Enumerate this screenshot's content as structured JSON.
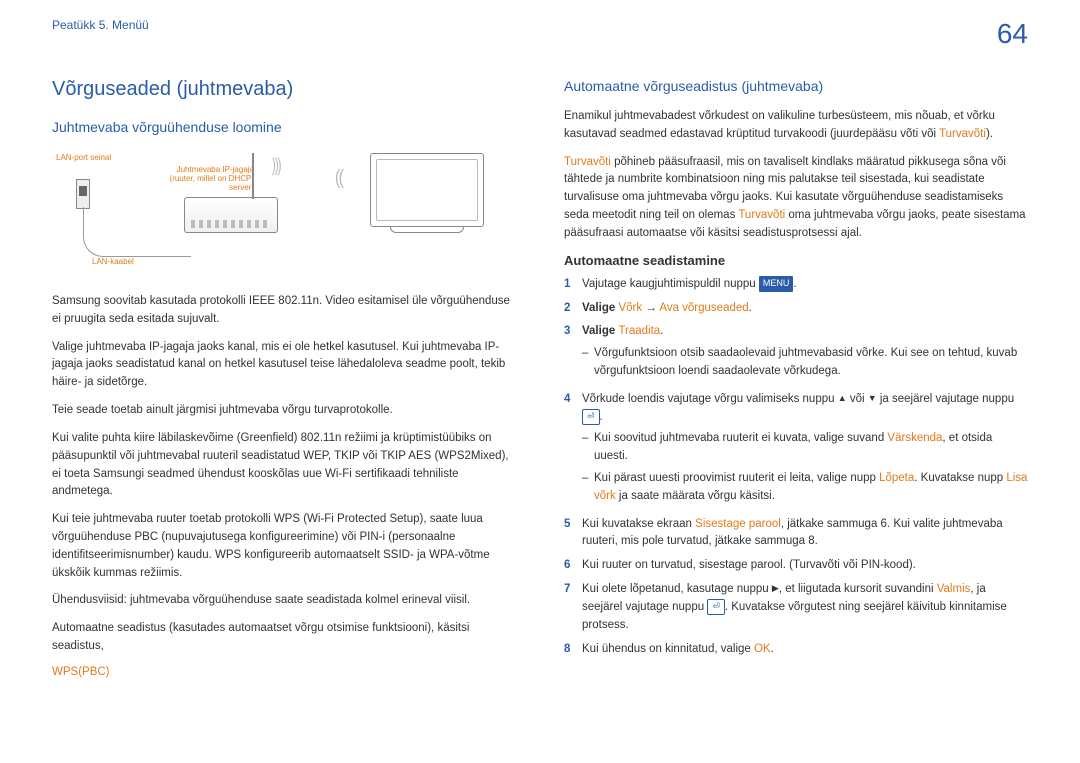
{
  "header": {
    "chapter": "Peatükk 5. Menüü",
    "page": "64"
  },
  "left": {
    "h1": "Võrguseaded (juhtmevaba)",
    "h2": "Juhtmevaba võrguühenduse loomine",
    "diag": {
      "lanport": "LAN-port seinal",
      "router": "Juhtmevaba IP-jagaja (ruuter, millel on DHCP-server)",
      "cable": "LAN-kaabel"
    },
    "p1": "Samsung soovitab kasutada protokolli IEEE 802.11n. Video esitamisel üle võrguühenduse ei pruugita seda esitada sujuvalt.",
    "p2": "Valige juhtmevaba IP-jagaja jaoks kanal, mis ei ole hetkel kasutusel. Kui juhtmevaba IP-jagaja jaoks seadistatud kanal on hetkel kasutusel teise lähedaloleva seadme poolt, tekib häire- ja sidetõrge.",
    "p3": "Teie seade toetab ainult järgmisi juhtmevaba võrgu turvaprotokolle.",
    "p4": "Kui valite puhta kiire läbilaskevõime (Greenfield) 802.11n režiimi ja krüptimistüübiks on pääsupunktil või juhtmevabal ruuteril seadistatud WEP, TKIP või TKIP AES (WPS2Mixed), ei toeta Samsungi seadmed ühendust kooskõlas uue Wi-Fi sertifikaadi tehniliste andmetega.",
    "p5": "Kui teie juhtmevaba ruuter toetab protokolli WPS (Wi-Fi Protected Setup), saate luua võrguühenduse PBC (nupuvajutusega konfigureerimine) või PIN-i (personaalne identifitseerimisnumber) kaudu. WPS konfigureerib automaatselt SSID- ja WPA-võtme ükskõik kummas režiimis.",
    "p6": "Ühendusviisid: juhtmevaba võrguühenduse saate seadistada kolmel erineval viisil.",
    "p7": "Automaatne seadistus (kasutades automaatset võrgu otsimise funktsiooni), käsitsi seadistus,",
    "wps": "WPS(PBC)"
  },
  "right": {
    "h2": "Automaatne võrguseadistus (juhtmevaba)",
    "p1a": "Enamikul juhtmevabadest võrkudest on valikuline turbesüsteem, mis nõuab, et võrku kasutavad seadmed edastavad krüptitud turvakoodi (juurdepääsu võti või ",
    "p1b": ").",
    "turvavoti": "Turvavõti",
    "p2a": " põhineb pääsufraasil, mis on tavaliselt kindlaks määratud pikkusega sõna või tähtede ja numbrite kombinatsioon ning mis palutakse teil sisestada, kui seadistate turvalisuse oma juhtmevaba võrgu jaoks. Kui kasutate võrguühenduse seadistamiseks seda meetodit ning teil on olemas ",
    "p2b": " oma juhtmevaba võrgu jaoks, peate sisestama pääsufraasi automaatse või käsitsi seadistusprotsessi ajal.",
    "h3": "Automaatne seadistamine",
    "menu": "MENU",
    "steps": {
      "s1": "Vajutage kaugjuhtimispuldil nuppu ",
      "s2a": "Valige ",
      "s2b": "Võrk",
      "s2c": " → ",
      "s2d": "Ava võrguseaded",
      "s3a": "Valige ",
      "s3b": "Traadita",
      "s3sub1": "Võrgufunktsioon otsib saadaolevaid juhtmevabasid võrke. Kui see on tehtud, kuvab võrgufunktsioon loendi saadaolevate võrkudega.",
      "s4a": "Võrkude loendis vajutage võrgu valimiseks nuppu ",
      "s4b": " või ",
      "s4c": " ja seejärel vajutage nuppu ",
      "s4sub1a": "Kui soovitud juhtmevaba ruuterit ei kuvata, valige suvand ",
      "s4sub1b": "Värskenda",
      "s4sub1c": ", et otsida uuesti.",
      "s4sub2a": "Kui pärast uuesti proovimist ruuterit ei leita, valige nupp ",
      "s4sub2b": "Lõpeta",
      "s4sub2c": ". Kuvatakse nupp ",
      "s4sub2d": "Lisa võrk",
      "s4sub2e": " ja saate määrata võrgu käsitsi.",
      "s5a": "Kui kuvatakse ekraan ",
      "s5b": "Sisestage parool",
      "s5c": ", jätkake sammuga 6. Kui valite juhtmevaba ruuteri, mis pole turvatud, jätkake sammuga 8.",
      "s6": "Kui ruuter on turvatud, sisestage parool. (Turvavõti või PIN-kood).",
      "s7a": "Kui olete lõpetanud, kasutage nuppu ",
      "s7b": ", et liigutada kursorit suvandini ",
      "s7c": "Valmis",
      "s7d": ", ja seejärel vajutage nuppu ",
      "s7e": ". Kuvatakse võrgutest ning seejärel käivitub kinnitamise protsess.",
      "s8a": "Kui ühendus on kinnitatud, valige ",
      "s8b": "OK"
    }
  }
}
